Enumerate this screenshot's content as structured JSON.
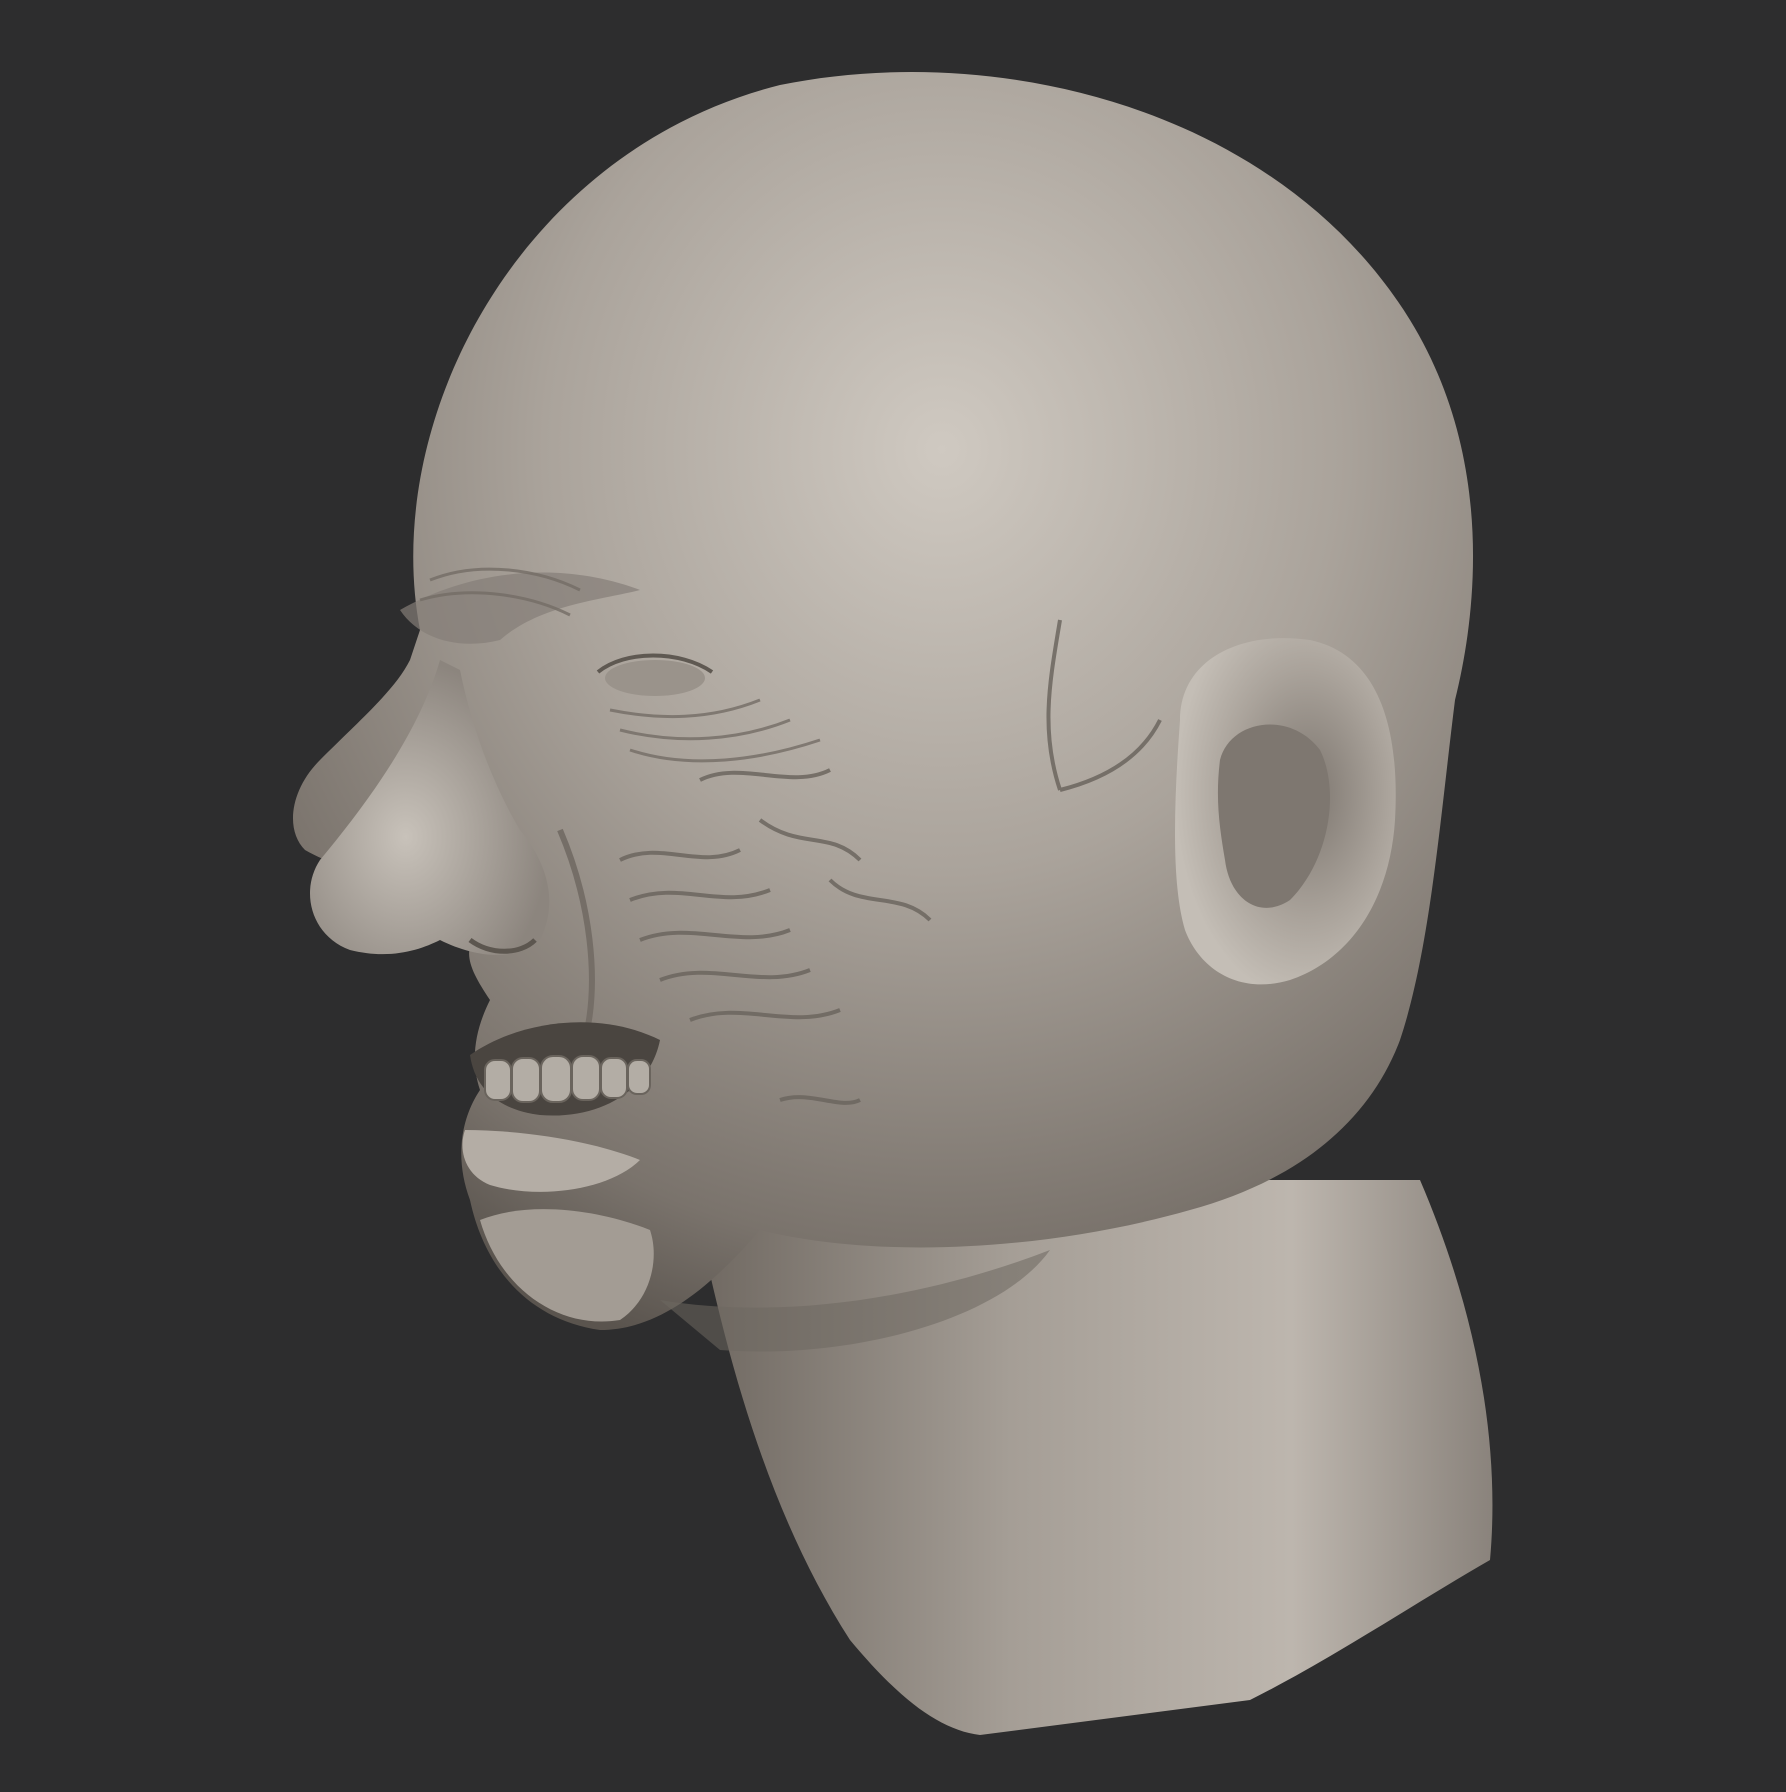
{
  "viewport": {
    "background_color": "#2d2d2e",
    "model_base_color": "#a49d95",
    "model_highlight_color": "#c9c3bb",
    "model_shadow_color": "#5e5852",
    "detail_color": "#7b746d"
  }
}
